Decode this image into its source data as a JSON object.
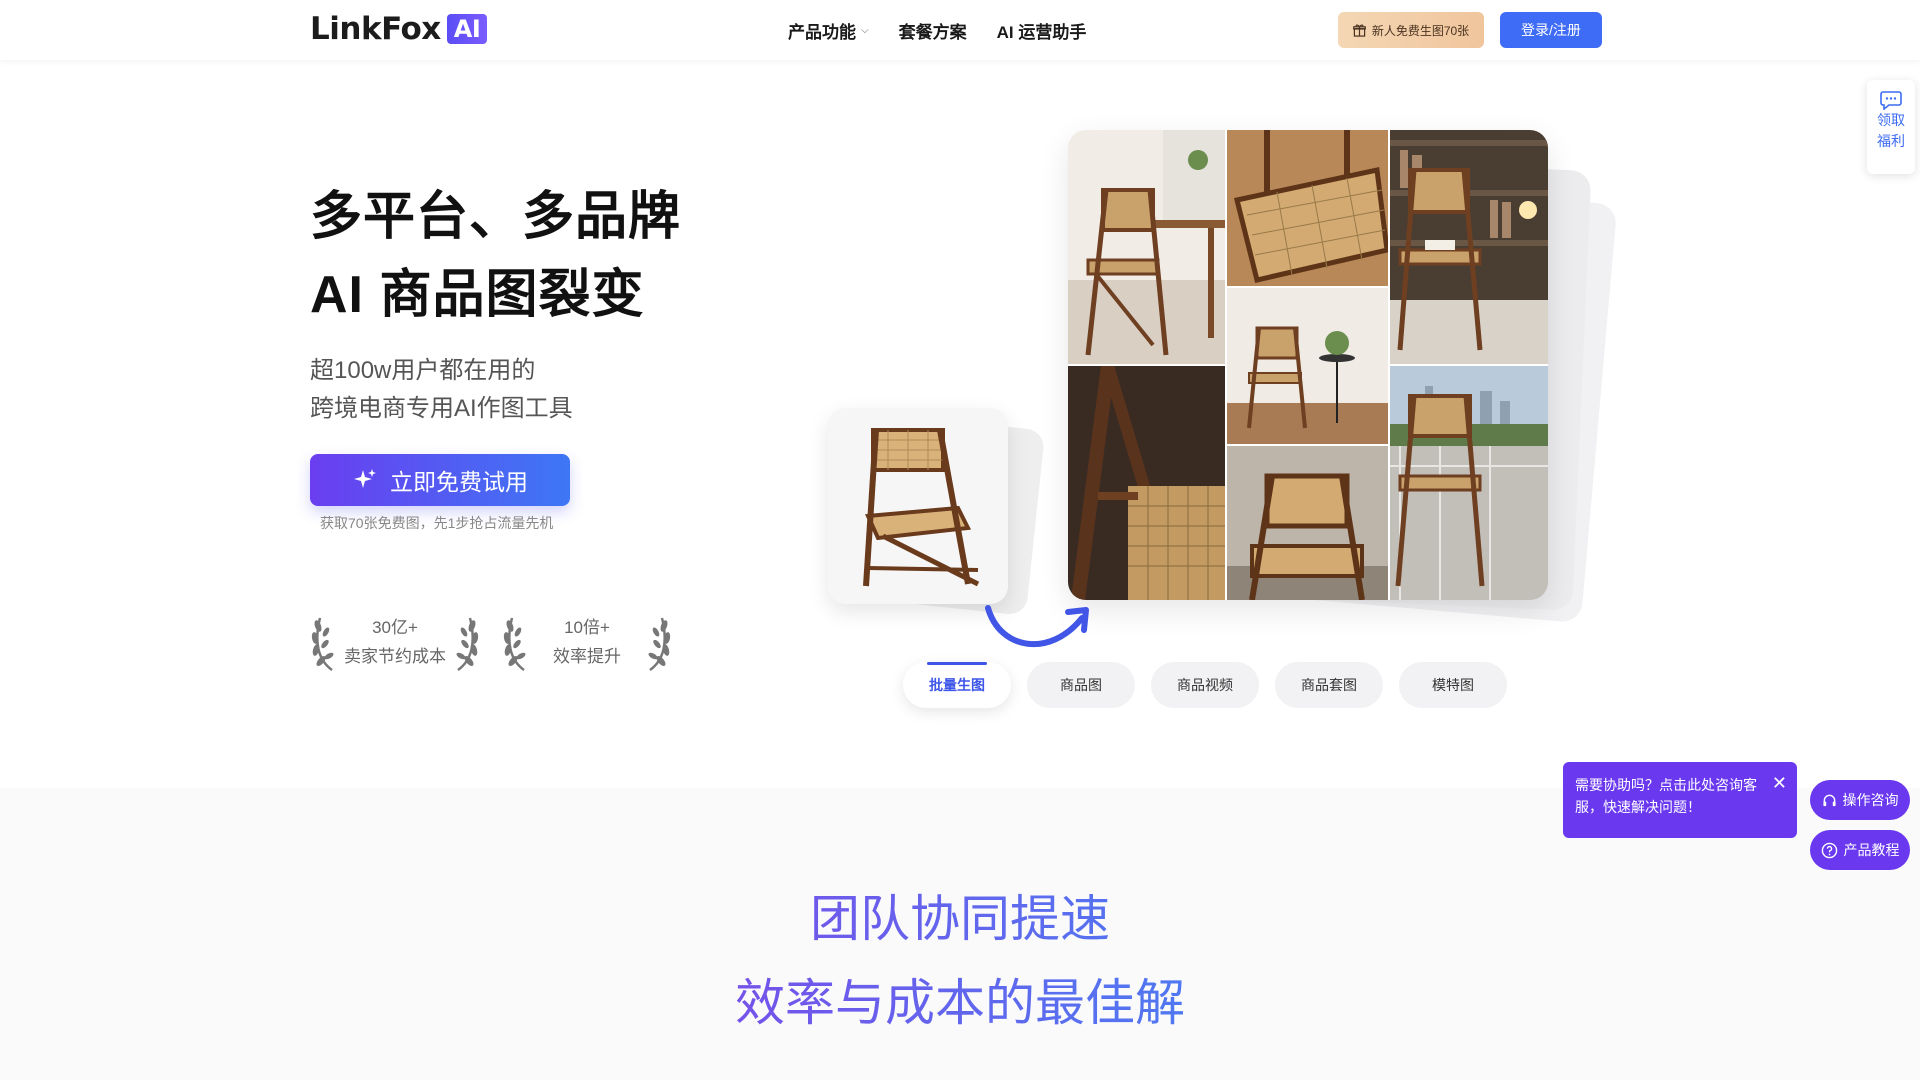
{
  "header": {
    "logo_text": "LinkFox",
    "logo_badge": "AI",
    "nav": [
      {
        "label": "产品功能",
        "has_dropdown": true
      },
      {
        "label": "套餐方案",
        "has_dropdown": false
      },
      {
        "label": "AI 运营助手",
        "has_dropdown": false
      }
    ],
    "gift_button": "新人免费生图70张",
    "login_button": "登录/注册"
  },
  "hero": {
    "title_line1": "多平台、多品牌",
    "title_line2": "AI 商品图裂变",
    "subtitle_line1": "超100w用户都在用的",
    "subtitle_line2": "跨境电商专用AI作图工具",
    "cta_label": "立即免费试用",
    "cta_note": "获取70张免费图，先1步抢占流量先机",
    "stats": [
      {
        "value": "30亿+",
        "label": "卖家节约成本"
      },
      {
        "value": "10倍+",
        "label": "效率提升"
      }
    ]
  },
  "tabs": [
    {
      "label": "批量生图",
      "active": true
    },
    {
      "label": "商品图",
      "active": false
    },
    {
      "label": "商品视频",
      "active": false
    },
    {
      "label": "商品套图",
      "active": false
    },
    {
      "label": "模特图",
      "active": false
    }
  ],
  "section2": {
    "title_line1": "团队协同提速",
    "title_line2": "效率与成本的最佳解"
  },
  "side": {
    "welfare_line1": "领取",
    "welfare_line2": "福利",
    "help_popup": "需要协助吗？点击此处咨询客服，快速解决问题！",
    "consult_button": "操作咨询",
    "tutorial_button": "产品教程"
  },
  "colors": {
    "accent_blue": "#3f6cf6",
    "accent_purple": "#6a38ef",
    "gift_gold": "#f0c59c"
  }
}
